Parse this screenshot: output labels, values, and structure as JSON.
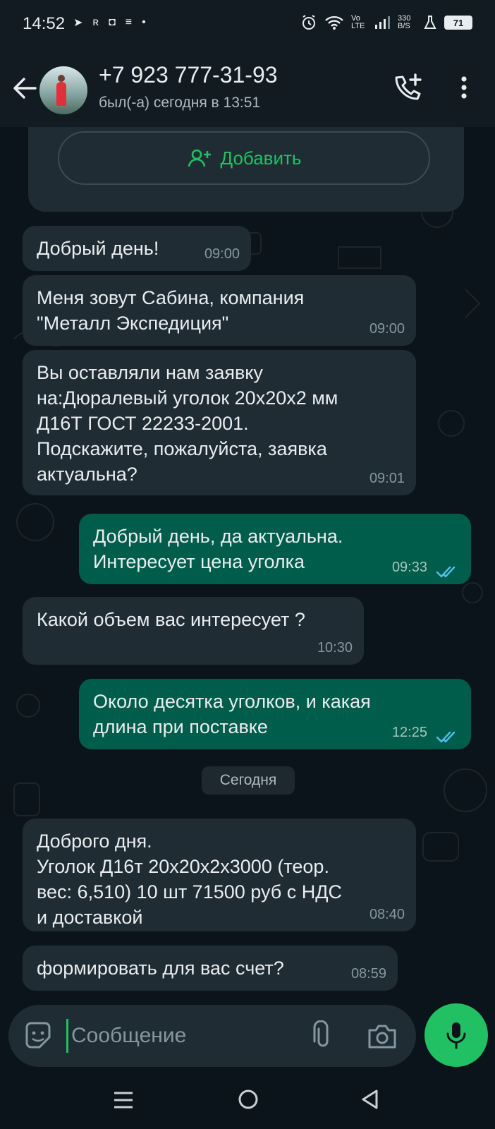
{
  "status_bar": {
    "time": "14:52",
    "left_icons": [
      "telegram-icon",
      "app-icon",
      "shield-icon",
      "notes-icon",
      "dot"
    ],
    "right_text_volte": "Vo LTE",
    "network_speed": "330 B/S",
    "battery": "71"
  },
  "header": {
    "contact": "+7 923 777-31-93",
    "last_seen": "был(-а) сегодня в 13:51"
  },
  "add_card": {
    "button_label": "Добавить"
  },
  "messages": [
    {
      "dir": "in",
      "text": "Добрый день!",
      "time": "09:00"
    },
    {
      "dir": "in",
      "text": "Меня зовут Сабина, компания\n\"Металл Экспедиция\"",
      "time": "09:00"
    },
    {
      "dir": "in",
      "text": "Вы оставляли нам заявку\nна:Дюралевый уголок 20х20х2 мм\nД16Т ГОСТ 22233-2001.\nПодскажите, пожалуйста, заявка\nактуальна?",
      "time": "09:01"
    },
    {
      "dir": "out",
      "text": "Добрый день, да актуальна.\nИнтересует цена уголка",
      "time": "09:33"
    },
    {
      "dir": "in",
      "text": "Какой объем вас интересует ?",
      "time": "10:30"
    },
    {
      "dir": "out",
      "text": "Около десятка уголков, и какая\nдлина при поставке",
      "time": "12:25"
    },
    {
      "dir": "in",
      "text": "Доброго дня.\nУголок Д16т 20х20х2х3000 (теор.\nвес: 6,510) 10 шт 71500 руб с НДС\nи доставкой",
      "time": "08:40"
    },
    {
      "dir": "in",
      "text": "формировать для вас счет?",
      "time": "08:59"
    }
  ],
  "date_chip": "Сегодня",
  "composer": {
    "placeholder": "Сообщение"
  },
  "colors": {
    "accent": "#21c063",
    "incoming_bubble": "#1f2c34",
    "outgoing_bubble": "#005c4b",
    "background": "#0b141a",
    "read_ticks": "#53bdeb"
  }
}
